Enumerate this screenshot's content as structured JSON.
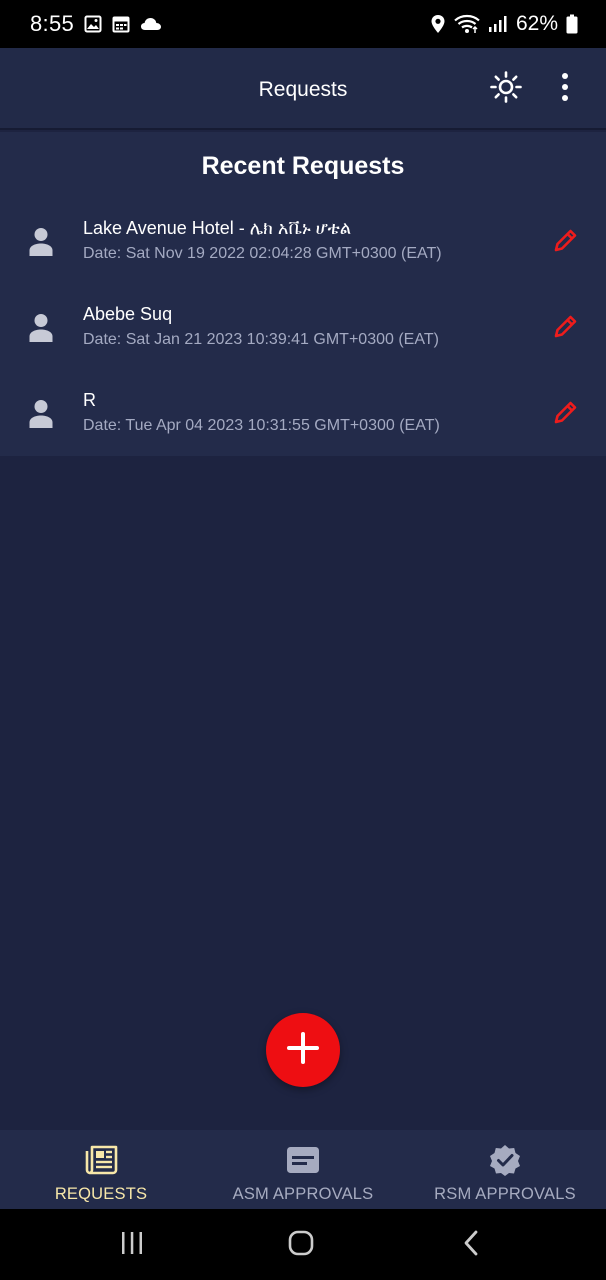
{
  "status_bar": {
    "time": "8:55",
    "battery_percent": "62%",
    "left_icons": [
      "image-icon",
      "calendar-icon",
      "cloud-icon"
    ],
    "right_icons": [
      "location-icon",
      "wifi-icon",
      "signal-icon",
      "battery-icon"
    ]
  },
  "app_bar": {
    "title": "Requests",
    "actions": [
      "brightness-icon",
      "more-vert-icon"
    ]
  },
  "main": {
    "section_title": "Recent Requests",
    "requests": [
      {
        "name": "Lake Avenue Hotel - ሌክ አቬኑ ሆቴል",
        "date": "Date: Sat Nov 19 2022 02:04:28 GMT+0300 (EAT)"
      },
      {
        "name": "Abebe Suq",
        "date": "Date: Sat Jan 21 2023 10:39:41 GMT+0300 (EAT)"
      },
      {
        "name": "R",
        "date": "Date: Tue Apr 04 2023 10:31:55 GMT+0300 (EAT)"
      }
    ]
  },
  "fab": {
    "icon": "plus-icon"
  },
  "bottom_nav": {
    "items": [
      {
        "label": "REQUESTS",
        "icon": "newspaper-icon",
        "active": true
      },
      {
        "label": "ASM APPROVALS",
        "icon": "card-icon",
        "active": false
      },
      {
        "label": "RSM APPROVALS",
        "icon": "verified-badge-icon",
        "active": false
      }
    ]
  },
  "colors": {
    "background": "#1d2340",
    "surface": "#232b4a",
    "accent_red": "#ee0e12",
    "active_tab": "#f7e7a9",
    "inactive_tab": "#a6abc0",
    "secondary_text": "#a4aac2"
  }
}
